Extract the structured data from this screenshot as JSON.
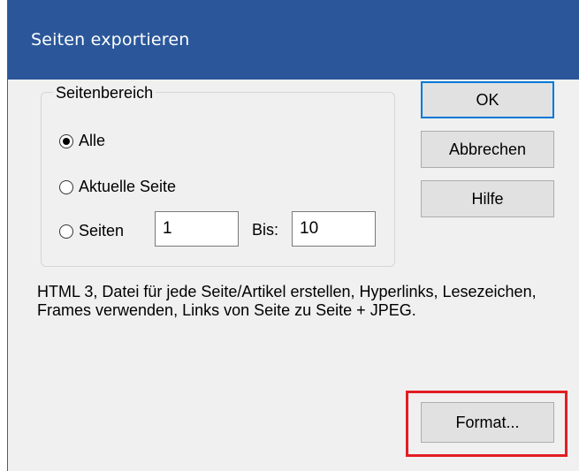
{
  "dialog": {
    "title": "Seiten exportieren"
  },
  "page_range": {
    "legend": "Seitenbereich",
    "options": [
      {
        "label": "Alle",
        "checked": true
      },
      {
        "label": "Aktuelle Seite",
        "checked": false
      },
      {
        "label": "Seiten",
        "checked": false
      }
    ],
    "from_value": "1",
    "to_label": "Bis:",
    "to_value": "10"
  },
  "buttons": {
    "ok": "OK",
    "cancel": "Abbrechen",
    "help": "Hilfe",
    "format": "Format..."
  },
  "description": "HTML 3, Datei für jede Seite/Artikel erstellen, Hyperlinks, Lesezeichen, Frames verwenden, Links von Seite zu Seite + JPEG.",
  "colors": {
    "titlebar": "#2b579a",
    "highlight": "#e31d24",
    "default_button_border": "#0078d7"
  }
}
